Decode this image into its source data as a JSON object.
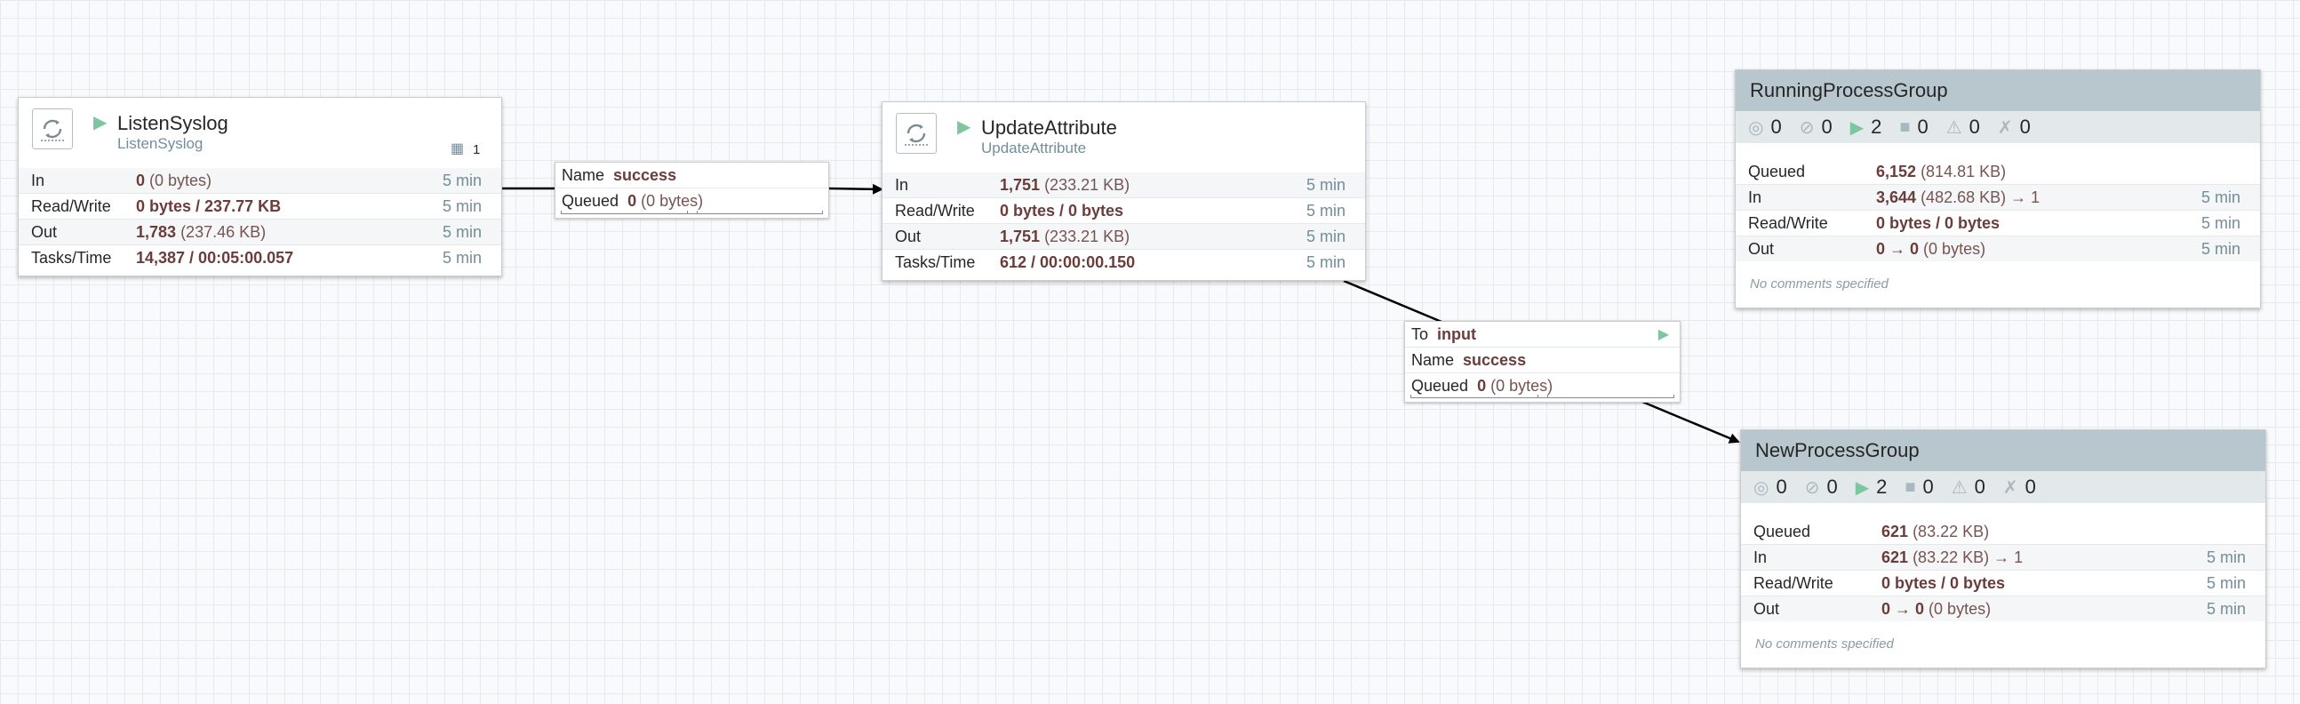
{
  "processors": [
    {
      "name": "ListenSyslog",
      "type": "ListenSyslog",
      "badge": "1",
      "rows": [
        {
          "key": "In",
          "value_bold": "0",
          "value_rest": "(0 bytes)",
          "time": "5 min"
        },
        {
          "key": "Read/Write",
          "value_bold": "0 bytes / 237.77 KB",
          "value_rest": "",
          "time": "5 min"
        },
        {
          "key": "Out",
          "value_bold": "1,783",
          "value_rest": "(237.46 KB)",
          "time": "5 min"
        },
        {
          "key": "Tasks/Time",
          "value_bold": "14,387 / 00:05:00.057",
          "value_rest": "",
          "time": "5 min"
        }
      ]
    },
    {
      "name": "UpdateAttribute",
      "type": "UpdateAttribute",
      "rows": [
        {
          "key": "In",
          "value_bold": "1,751",
          "value_rest": "(233.21 KB)",
          "time": "5 min"
        },
        {
          "key": "Read/Write",
          "value_bold": "0 bytes / 0 bytes",
          "value_rest": "",
          "time": "5 min"
        },
        {
          "key": "Out",
          "value_bold": "1,751",
          "value_rest": "(233.21 KB)",
          "time": "5 min"
        },
        {
          "key": "Tasks/Time",
          "value_bold": "612 / 00:00:00.150",
          "value_rest": "",
          "time": "5 min"
        }
      ]
    }
  ],
  "connections": [
    {
      "name_label": "Name",
      "name_value": "success",
      "queued_label": "Queued",
      "queued_bold": "0",
      "queued_rest": "(0 bytes)"
    },
    {
      "to_label": "To",
      "to_value": "input",
      "name_label": "Name",
      "name_value": "success",
      "queued_label": "Queued",
      "queued_bold": "0",
      "queued_rest": "(0 bytes)"
    }
  ],
  "process_groups": [
    {
      "name": "RunningProcessGroup",
      "stats": {
        "transmitting": "0",
        "not_transmitting": "0",
        "running": "2",
        "stopped": "0",
        "invalid": "0",
        "disabled": "0"
      },
      "rows": [
        {
          "key": "Queued",
          "value_bold": "6,152",
          "value_rest": "(814.81 KB)",
          "time": ""
        },
        {
          "key": "In",
          "value_bold": "3,644",
          "value_rest": "(482.68 KB) → 1",
          "time": "5 min"
        },
        {
          "key": "Read/Write",
          "value_bold": "0 bytes / 0 bytes",
          "value_rest": "",
          "time": "5 min"
        },
        {
          "key": "Out",
          "value_bold": "0 → 0",
          "value_rest": "(0 bytes)",
          "time": "5 min"
        }
      ],
      "comments": "No comments specified"
    },
    {
      "name": "NewProcessGroup",
      "stats": {
        "transmitting": "0",
        "not_transmitting": "0",
        "running": "2",
        "stopped": "0",
        "invalid": "0",
        "disabled": "0"
      },
      "rows": [
        {
          "key": "Queued",
          "value_bold": "621",
          "value_rest": "(83.22 KB)",
          "time": ""
        },
        {
          "key": "In",
          "value_bold": "621",
          "value_rest": "(83.22 KB) → 1",
          "time": "5 min"
        },
        {
          "key": "Read/Write",
          "value_bold": "0 bytes / 0 bytes",
          "value_rest": "",
          "time": "5 min"
        },
        {
          "key": "Out",
          "value_bold": "0 → 0",
          "value_rest": "(0 bytes)",
          "time": "5 min"
        }
      ],
      "comments": "No comments specified"
    }
  ],
  "icons": {
    "processor": "processor-icon",
    "play": "play-icon",
    "transmitting": "transmitting-icon",
    "not_transmitting": "not-transmitting-icon",
    "running": "play-icon",
    "stopped": "stop-icon",
    "invalid": "warning-icon",
    "disabled": "disabled-icon"
  },
  "colors": {
    "running": "#7dc7a0",
    "group_header": "#b8c7ce",
    "stats_bar": "#e3e8eb",
    "value": "#6a3c3a",
    "time": "#728e9b"
  }
}
